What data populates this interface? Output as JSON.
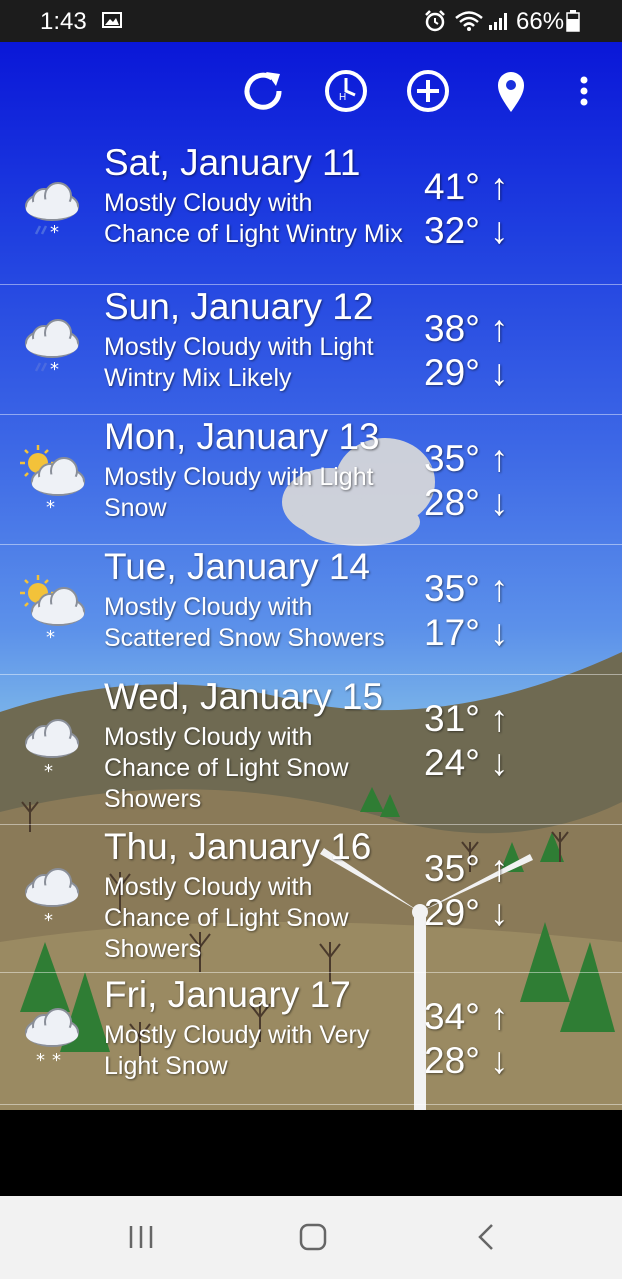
{
  "status_bar": {
    "time": "1:43",
    "battery": "66%",
    "icons": [
      "image-icon",
      "alarm-icon",
      "wifi-icon",
      "signal-icon",
      "battery-icon"
    ]
  },
  "toolbar": {
    "icons": [
      "refresh-icon",
      "hourly-clock-icon",
      "add-location-icon",
      "location-pin-icon",
      "overflow-menu-icon"
    ]
  },
  "forecast": [
    {
      "date": "Sat, January 11",
      "description": "Mostly Cloudy with Chance of Light Wintry Mix",
      "high": "41°",
      "low": "32°",
      "icon": "cloud-wintry-mix-icon"
    },
    {
      "date": "Sun, January 12",
      "description": "Mostly Cloudy with Light Wintry Mix Likely",
      "high": "38°",
      "low": "29°",
      "icon": "cloud-wintry-mix-icon"
    },
    {
      "date": "Mon, January 13",
      "description": "Mostly Cloudy with Light Snow",
      "high": "35°",
      "low": "28°",
      "icon": "sun-cloud-snow-icon"
    },
    {
      "date": "Tue, January 14",
      "description": "Mostly Cloudy with Scattered Snow Showers",
      "high": "35°",
      "low": "17°",
      "icon": "sun-cloud-snow-icon"
    },
    {
      "date": "Wed, January 15",
      "description": "Mostly Cloudy with Chance of Light Snow Showers",
      "high": "31°",
      "low": "24°",
      "icon": "cloud-snow-icon"
    },
    {
      "date": "Thu, January 16",
      "description": "Mostly Cloudy with Chance of Light Snow Showers",
      "high": "35°",
      "low": "29°",
      "icon": "cloud-snow-icon"
    },
    {
      "date": "Fri, January 17",
      "description": "Mostly Cloudy with Very Light Snow",
      "high": "34°",
      "low": "28°",
      "icon": "cloud-heavy-snow-icon"
    }
  ],
  "arrows": {
    "up": "↑",
    "down": "↓"
  },
  "colors": {
    "sky_top": "#0a17d8",
    "sky_mid": "#5c91ea",
    "hill": "#7d6f52",
    "tree": "#2f7d34",
    "accent_text": "#ffffff"
  },
  "nav_bar": {
    "icons": [
      "recent-apps-icon",
      "home-icon",
      "back-icon"
    ]
  }
}
